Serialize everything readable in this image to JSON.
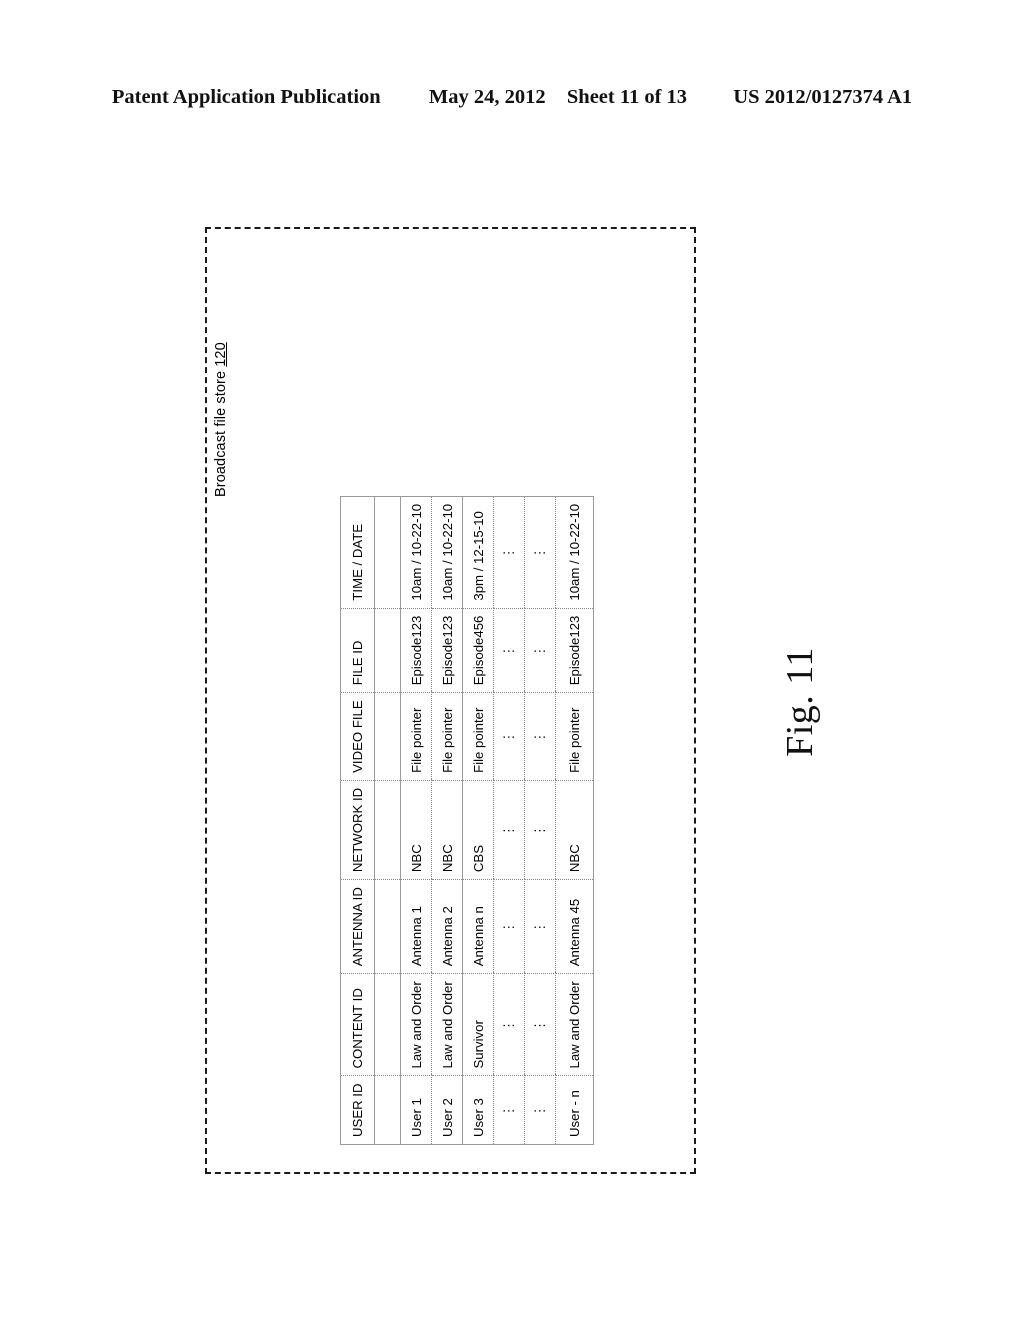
{
  "page_header": {
    "publication": "Patent Application Publication",
    "date": "May 24, 2012",
    "sheet": "Sheet 11 of 13",
    "doc_number": "US 2012/0127374 A1"
  },
  "figure": {
    "caption": "Fig. 11",
    "store_label_text": "Broadcast file store ",
    "store_label_number": "120"
  },
  "table": {
    "headers": [
      "USER ID",
      "CONTENT ID",
      "ANTENNA ID",
      "NETWORK ID",
      "VIDEO FILE",
      "FILE ID",
      "TIME / DATE"
    ],
    "rows": [
      {
        "user_id": "User 1",
        "content_id": "Law and Order",
        "antenna_id": "Antenna 1",
        "network_id": "NBC",
        "video_file": "File pointer",
        "file_id": "Episode123",
        "time_date": "10am / 10-22-10"
      },
      {
        "user_id": "User 2",
        "content_id": "Law and Order",
        "antenna_id": "Antenna 2",
        "network_id": "NBC",
        "video_file": "File pointer",
        "file_id": "Episode123",
        "time_date": "10am / 10-22-10"
      },
      {
        "user_id": "User 3",
        "content_id": "Survivor",
        "antenna_id": "Antenna n",
        "network_id": "CBS",
        "video_file": "File pointer",
        "file_id": "Episode456",
        "time_date": "3pm / 12-15-10"
      },
      {
        "user_id": "⋮",
        "content_id": "⋮",
        "antenna_id": "⋮",
        "network_id": "⋮",
        "video_file": "⋮",
        "file_id": "⋮",
        "time_date": "⋮"
      },
      {
        "user_id": "⋮",
        "content_id": "⋮",
        "antenna_id": "⋮",
        "network_id": "⋮",
        "video_file": "⋮",
        "file_id": "⋮",
        "time_date": "⋮"
      },
      {
        "user_id": "User - n",
        "content_id": "Law and Order",
        "antenna_id": "Antenna 45",
        "network_id": "NBC",
        "video_file": "File pointer",
        "file_id": "Episode123",
        "time_date": "10am / 10-22-10"
      }
    ]
  }
}
